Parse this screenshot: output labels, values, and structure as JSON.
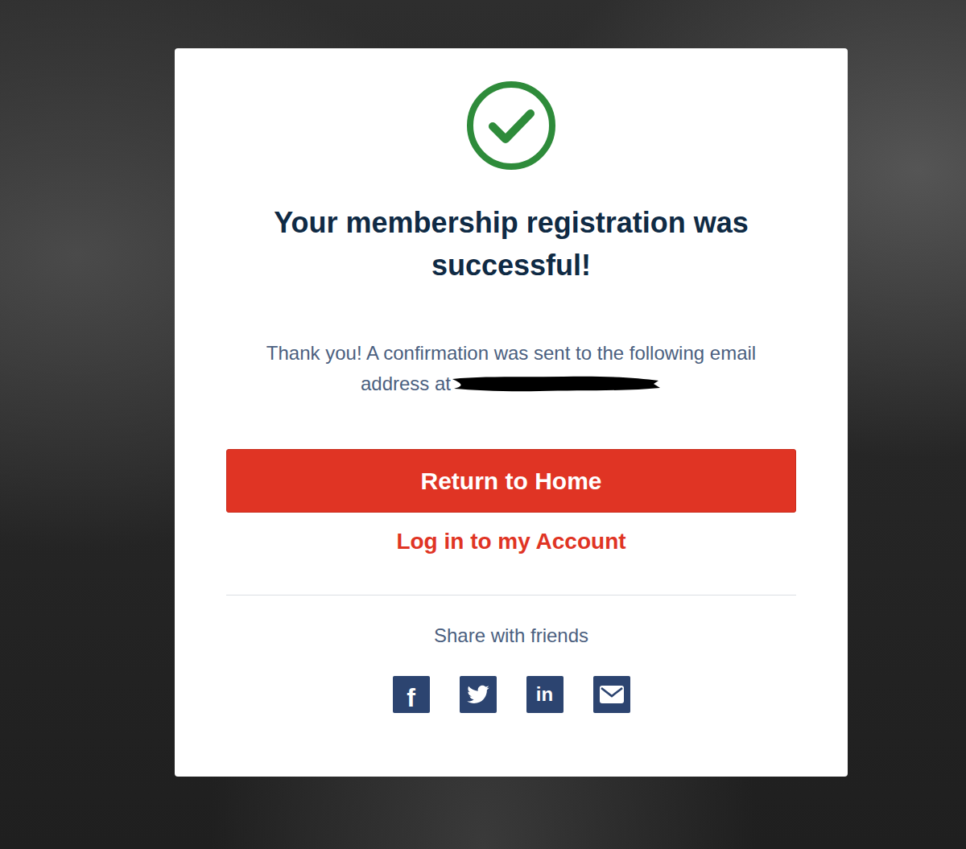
{
  "card": {
    "title": "Your membership registration was successful!",
    "message": "Thank you! A confirmation was sent to the following email address at",
    "primary_button": "Return to Home",
    "login_link": "Log in to my Account",
    "share_label": "Share with friends"
  },
  "share_buttons": [
    {
      "kind": "facebook",
      "glyph": "f"
    },
    {
      "kind": "twitter",
      "glyph": ""
    },
    {
      "kind": "linkedin",
      "glyph": "in"
    },
    {
      "kind": "email",
      "glyph": ""
    }
  ]
}
